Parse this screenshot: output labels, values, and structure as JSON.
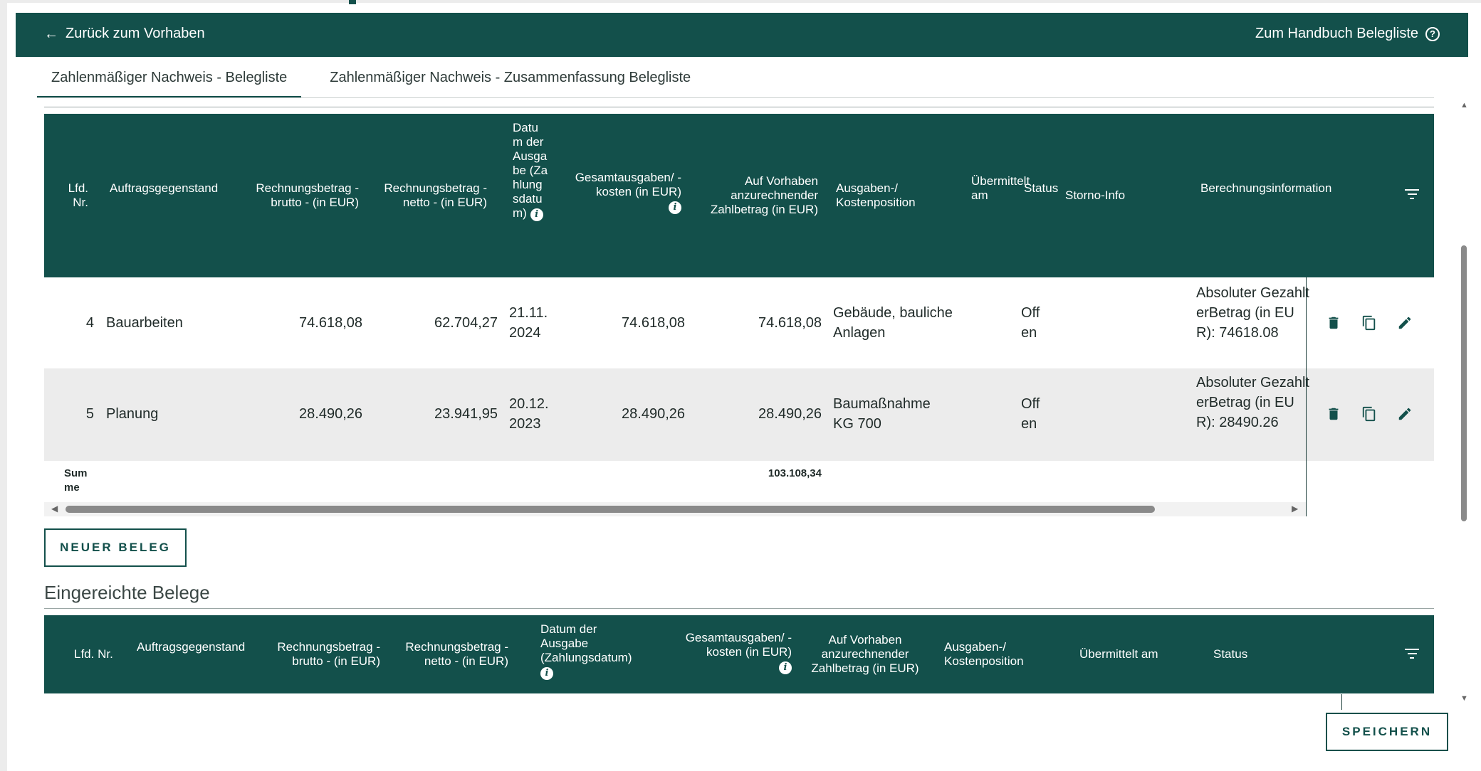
{
  "header": {
    "back_label": "Zurück zum Vorhaben",
    "handbook_label": "Zum Handbuch Belegliste",
    "colors": {
      "primary": "#13504b",
      "row_alt": "#ececec"
    }
  },
  "tabs": [
    {
      "label": "Zahlenmäßiger Nachweis - Belegliste",
      "active": true
    },
    {
      "label": "Zahlenmäßiger Nachweis - Zusammenfassung Belegliste",
      "active": false
    }
  ],
  "table1": {
    "columns": {
      "lfd_nr": "Lfd. Nr.",
      "auftrag": "Auftragsgegenstand",
      "brutto": "Rechnungsbetrag - brutto - (in EUR)",
      "netto": "Rechnungsbetrag - netto - (in EUR)",
      "datum": "Datum der Ausgabe (Zahlungsdatum)",
      "gesamt": "Gesamtausgaben/ -kosten (in EUR)",
      "zahlbetrag": "Auf Vorhaben anzurechnender Zahlbetrag (in EUR)",
      "position": "Ausgaben-/ Kostenposition",
      "uebermittelt": "Übermittelt am",
      "status": "Status",
      "storno": "Storno-Info",
      "berechnung": "Berechnungsinformation"
    },
    "rows": [
      {
        "lfd_nr": "4",
        "auftrag": "Bauarbeiten",
        "brutto": "74.618,08",
        "netto": "62.704,27",
        "datum": "21.11.2024",
        "gesamt": "74.618,08",
        "zahlbetrag": "74.618,08",
        "position": "Gebäude, bauliche Anlagen",
        "uebermittelt": "",
        "status": "Offen",
        "storno": "",
        "berechnung": "Absoluter GezahlterBetrag (in EUR): 74618.08"
      },
      {
        "lfd_nr": "5",
        "auftrag": "Planung",
        "brutto": "28.490,26",
        "netto": "23.941,95",
        "datum": "20.12.2023",
        "gesamt": "28.490,26",
        "zahlbetrag": "28.490,26",
        "position": "Baumaßnahme KG 700",
        "uebermittelt": "",
        "status": "Offen",
        "storno": "",
        "berechnung": "Absoluter GezahlterBetrag (in EUR): 28490.26"
      }
    ],
    "sum_label": "Summe",
    "sum_value": "103.108,34",
    "row_icons": [
      "trash-icon",
      "copy-icon",
      "pencil-icon"
    ]
  },
  "buttons": {
    "new_receipt": "NEUER BELEG",
    "save": "SPEICHERN"
  },
  "table2": {
    "title": "Eingereichte Belege",
    "columns": {
      "lfd_nr": "Lfd. Nr.",
      "auftrag": "Auftragsgegenstand",
      "brutto": "Rechnungsbetrag - brutto - (in EUR)",
      "netto": "Rechnungsbetrag - netto - (in EUR)",
      "datum": "Datum der Ausgabe (Zahlungsdatum)",
      "gesamt": "Gesamtausgaben/ -kosten (in EUR)",
      "zahlbetrag": "Auf Vorhaben anzurechnender Zahlbetrag (in EUR)",
      "position": "Ausgaben-/ Kostenposition",
      "uebermittelt": "Übermittelt am",
      "status": "Status"
    }
  }
}
